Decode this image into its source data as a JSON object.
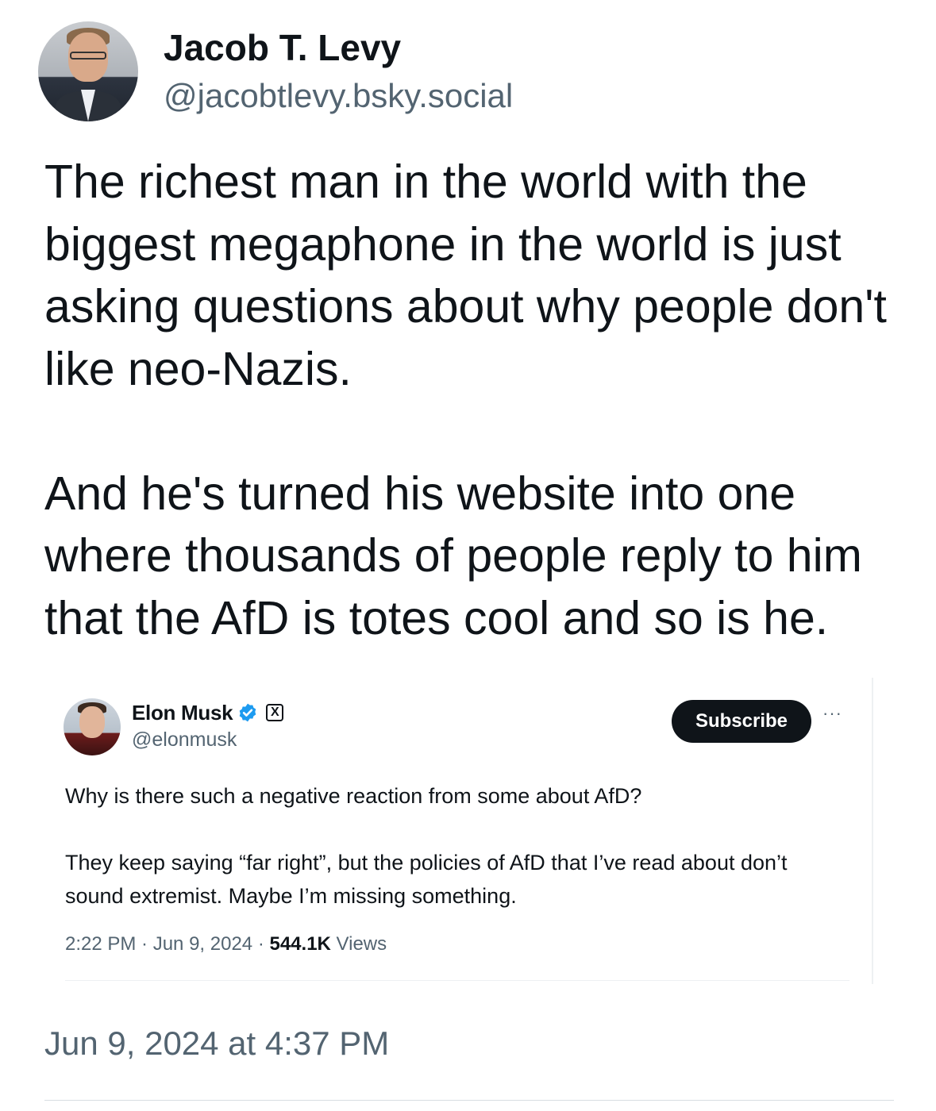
{
  "author": {
    "name": "Jacob T. Levy",
    "handle": "@jacobtlevy.bsky.social"
  },
  "post": {
    "paragraph_1": "The richest man in the world with the biggest megaphone in the world is just asking questions about why people don't like neo-Nazis.",
    "paragraph_2": "And he's turned his website into one where thousands of people reply to him that the AfD is totes cool and so is he.",
    "date": "Jun 9, 2024 at 4:37 PM"
  },
  "embed": {
    "name": "Elon Musk",
    "handle": "@elonmusk",
    "verified_icon": "verified-badge-icon",
    "x_icon": "x-logo-icon",
    "x_glyph": "X",
    "subscribe_label": "Subscribe",
    "more_label": "···",
    "text_1": "Why is there such a negative reaction from some about AfD?",
    "text_2": "They keep saying “far right”, but the policies of AfD that I’ve read about don’t sound extremist. Maybe I’m missing something.",
    "time": "2:22 PM · Jun 9, 2024 · ",
    "views_count": "544.1K",
    "views_label": " Views",
    "accent_color": "#1d9bf0"
  }
}
